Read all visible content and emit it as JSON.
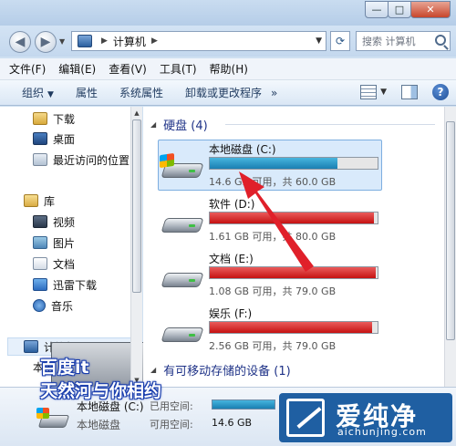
{
  "window": {
    "minimize": "—",
    "maximize": "□",
    "close": "✕"
  },
  "address": {
    "crumb": "计算机",
    "search_placeholder": "搜索 计算机"
  },
  "menu": [
    "文件(F)",
    "编辑(E)",
    "查看(V)",
    "工具(T)",
    "帮助(H)"
  ],
  "toolbar": {
    "organize": "组织",
    "properties": "属性",
    "system_properties": "系统属性",
    "uninstall": "卸载或更改程序",
    "more": "»"
  },
  "nav": {
    "downloads": "下载",
    "desktop": "桌面",
    "recent": "最近访问的位置",
    "library": "库",
    "video": "视频",
    "pictures": "图片",
    "documents": "文档",
    "xunlei": "迅雷下载",
    "music": "音乐",
    "computer": "计算机",
    "drive_c": "本地磁盘 (C:)"
  },
  "content": {
    "hdd_group": "硬盘 (4)",
    "removable_group": "有可移动存储的设备 (1)",
    "drives": [
      {
        "name": "本地磁盘 (C:)",
        "free_text": "14.6 GB 可用，共 60.0 GB",
        "used_fraction": 0.76,
        "color": "#1a7fb2"
      },
      {
        "name": "软件 (D:)",
        "free_text": "1.61 GB 可用，共 80.0 GB",
        "used_fraction": 0.98,
        "color": "#c51212"
      },
      {
        "name": "文档 (E:)",
        "free_text": "1.08 GB 可用，共 79.0 GB",
        "used_fraction": 0.99,
        "color": "#c51212"
      },
      {
        "name": "娱乐 (F:)",
        "free_text": "2.56 GB 可用，共 79.0 GB",
        "used_fraction": 0.97,
        "color": "#c51212"
      }
    ]
  },
  "details": {
    "name": "本地磁盘 (C:)",
    "type": "本地磁盘",
    "used_label": "已用空间:",
    "free_label": "可用空间:",
    "free_value": "14.6 GB"
  },
  "overlay": {
    "line1": "百度it",
    "line2": "天然河与你相约"
  },
  "watermark": {
    "text": "爱纯净",
    "url": "aichunjing.com"
  },
  "colors": {
    "accent": "#1f5fa2",
    "annotation_arrow": "#e0202a"
  }
}
